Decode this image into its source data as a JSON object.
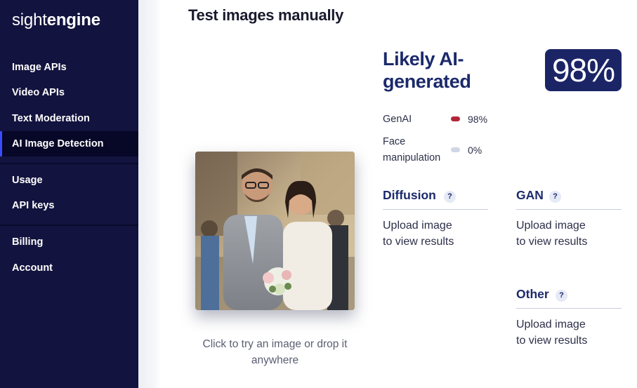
{
  "brand": {
    "light": "sight",
    "bold": "engine"
  },
  "sidebar": {
    "items": [
      {
        "label": "Image APIs"
      },
      {
        "label": "Video APIs"
      },
      {
        "label": "Text Moderation"
      },
      {
        "label": "AI Image Detection",
        "active": true
      },
      {
        "label": "Usage"
      },
      {
        "label": "API keys"
      },
      {
        "label": "Billing"
      },
      {
        "label": "Account"
      }
    ]
  },
  "page": {
    "title": "Test images manually"
  },
  "upload": {
    "hint": "Click to try an image or drop it anywhere",
    "image_alt": "wedding couple photo",
    "icon": "photo"
  },
  "result": {
    "verdict": "Likely AI-generated",
    "score": "98%",
    "metrics": [
      {
        "label": "GenAI",
        "value": "98%",
        "fraction": 0.98,
        "color": "#b3263a"
      },
      {
        "label": "Face manipulation",
        "value": "0%",
        "fraction": 0.0,
        "color": "#cfd6e6"
      }
    ],
    "sections": [
      {
        "title": "Diffusion",
        "help": "?",
        "body": "Upload image to view results"
      },
      {
        "title": "GAN",
        "help": "?",
        "body": "Upload image to view results"
      },
      {
        "title": "Other",
        "help": "?",
        "body": "Upload image to view results"
      }
    ]
  },
  "colors": {
    "sidebar_bg": "#13133f",
    "accent": "#1b2566",
    "genai_bar": "#b3263a"
  }
}
